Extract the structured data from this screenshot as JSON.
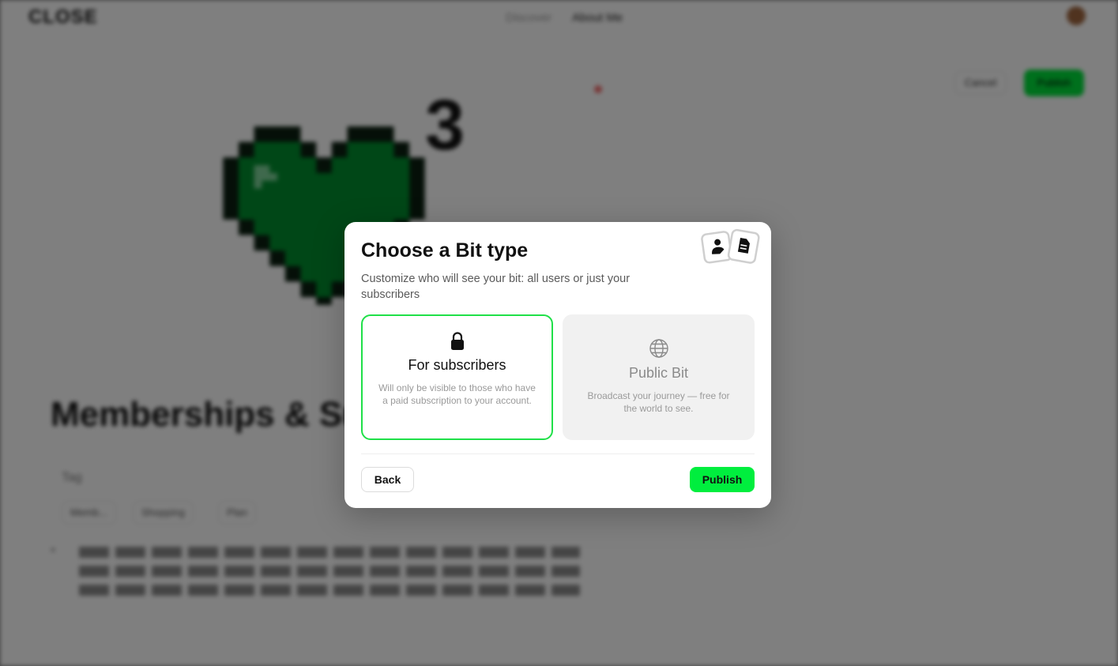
{
  "background": {
    "logo": "CLOSE",
    "nav": [
      "Discover",
      "About Me"
    ],
    "cancel_label": "Cancel",
    "publish_label": "Publish",
    "superscript": "3",
    "title": "Memberships & Support",
    "tag_label": "Tag",
    "chips": [
      "Memb...",
      "Shopping",
      "Plan"
    ]
  },
  "modal": {
    "title": "Choose a Bit type",
    "description": "Customize who will see your bit: all users or just your subscribers",
    "options": [
      {
        "icon": "lock-icon",
        "title": "For subscribers",
        "text": "Will only be visible to those who have a paid subscription to your account.",
        "selected": true
      },
      {
        "icon": "globe-icon",
        "title": "Public Bit",
        "text": "Broadcast your journey — free for the world to see.",
        "selected": false
      }
    ],
    "back_label": "Back",
    "publish_label": "Publish"
  },
  "colors": {
    "accent": "#00EE3E",
    "selected_border": "#1FE048",
    "heart": "#008F2E"
  }
}
